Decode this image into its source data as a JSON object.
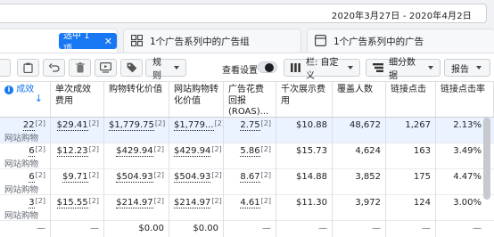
{
  "date_range": "2020年3月27日 - 2020年4月2日",
  "tabs": {
    "selected_chip": "选中 1 项",
    "adsets_label": "1个广告系列中的广告组",
    "ads_label": "1个广告系列中的广告"
  },
  "toolbar": {
    "rules_label": "规则",
    "view_setup_label": "查看设置",
    "columns_label": "栏: 自定义",
    "breakdown_label": "细分数据",
    "reports_label": "报告"
  },
  "table": {
    "headers": {
      "c0": "成效",
      "c1": "单次成效费用",
      "c2": "购物转化价值",
      "c3": "网站购物转化价值",
      "c4": "广告花费回报 (ROAS)...",
      "c5": "千次展示费用",
      "c6": "覆盖人数",
      "c7": "链接点击",
      "c8": "链接点击率"
    },
    "rows": [
      {
        "results": "22",
        "results_sup": "[2]",
        "results_sub": "网站购物",
        "cpr": "$29.41",
        "cpr_sup": "[2]",
        "conv_value": "$1,779.75",
        "conv_sup": "[2]",
        "web_conv_value": "$1,779...",
        "web_conv_sup": "[2]",
        "roas": "2.75",
        "roas_sup": "[2]",
        "cpm": "$10.88",
        "reach": "48,672",
        "clicks": "1,267",
        "ctr": "2.13%"
      },
      {
        "results": "6",
        "results_sup": "[2]",
        "results_sub": "网站购物",
        "cpr": "$12.23",
        "cpr_sup": "[2]",
        "conv_value": "$429.94",
        "conv_sup": "[2]",
        "web_conv_value": "$429.94",
        "web_conv_sup": "[2]",
        "roas": "5.86",
        "roas_sup": "[2]",
        "cpm": "$15.73",
        "reach": "4,624",
        "clicks": "163",
        "ctr": "3.49%"
      },
      {
        "results": "6",
        "results_sup": "[2]",
        "results_sub": "网站购物",
        "cpr": "$9.71",
        "cpr_sup": "[2]",
        "conv_value": "$504.93",
        "conv_sup": "[2]",
        "web_conv_value": "$504.93",
        "web_conv_sup": "[2]",
        "roas": "8.67",
        "roas_sup": "[2]",
        "cpm": "$14.88",
        "reach": "3,852",
        "clicks": "175",
        "ctr": "4.47%"
      },
      {
        "results": "3",
        "results_sup": "[2]",
        "results_sub": "网站购物",
        "cpr": "$15.55",
        "cpr_sup": "[2]",
        "conv_value": "$214.97",
        "conv_sup": "[2]",
        "web_conv_value": "$214.97",
        "web_conv_sup": "[2]",
        "roas": "4.61",
        "roas_sup": "[2]",
        "cpm": "$11.30",
        "reach": "3,972",
        "clicks": "124",
        "ctr": "3.00%"
      },
      {
        "results": "—",
        "results_sup": "",
        "results_sub": "",
        "cpr": "—",
        "cpr_sup": "",
        "conv_value": "$0.00",
        "conv_sup": "",
        "web_conv_value": "$0.00",
        "web_conv_sup": "",
        "roas": "—",
        "roas_sup": "",
        "cpm": "—",
        "reach": "—",
        "clicks": "—",
        "ctr": "—"
      }
    ]
  },
  "colors": {
    "accent": "#1877f2",
    "highlight_row": "#eaf3ff",
    "border": "#dddfe2"
  }
}
